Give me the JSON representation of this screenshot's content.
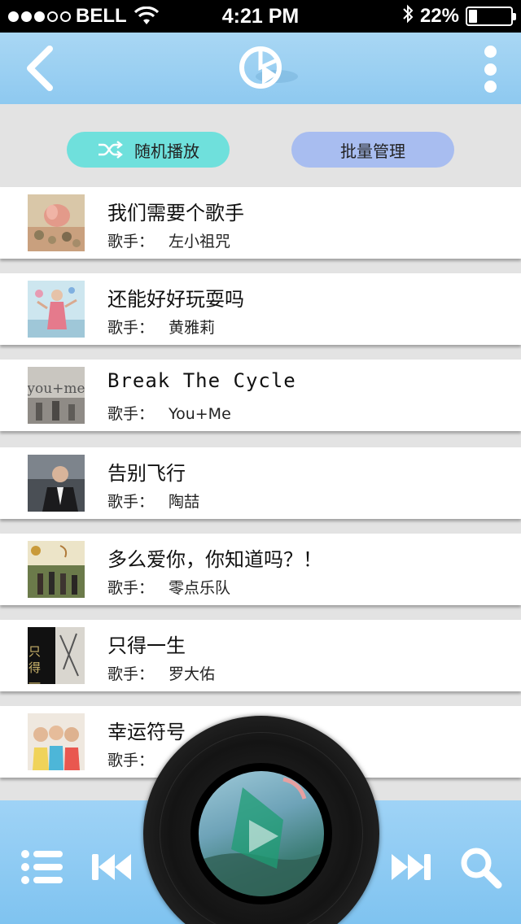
{
  "status_bar": {
    "carrier": "BELL",
    "time": "4:21 PM",
    "battery": "22%",
    "battery_level": 0.22,
    "signal_bars": 3,
    "signal_total": 5
  },
  "nav": {
    "back_icon": "chevron-left-icon",
    "logo_icon": "music-app-logo-icon",
    "more_icon": "vertical-dots-icon"
  },
  "actions": {
    "shuffle_label": "随机播放",
    "shuffle_icon": "shuffle-icon",
    "batch_label": "批量管理"
  },
  "artist_prefix": "歌手：",
  "songs": [
    {
      "title": "我们需要个歌手",
      "artist": "左小祖咒"
    },
    {
      "title": "还能好好玩耍吗",
      "artist": "黄雅莉"
    },
    {
      "title": "Break The Cycle",
      "artist": "You+Me"
    },
    {
      "title": "告别飞行",
      "artist": "陶喆"
    },
    {
      "title": "多么爱你，你知道吗？！",
      "artist": "零点乐队"
    },
    {
      "title": "只得一生",
      "artist": "罗大佑"
    },
    {
      "title": "幸运符号",
      "artist": ""
    }
  ],
  "cover_art": {
    "song3_text": "you+me",
    "song6_text": "只 得 一 生"
  },
  "player": {
    "playlist_icon": "playlist-icon",
    "prev_icon": "previous-track-icon",
    "play_icon": "play-icon",
    "next_icon": "next-track-icon",
    "search_icon": "search-icon"
  },
  "colors": {
    "nav_bar": "#a9d7f4",
    "shuffle_pill": "#6fe0dc",
    "batch_pill": "#a8bdf0",
    "player_bar": "#8ecbf3"
  }
}
